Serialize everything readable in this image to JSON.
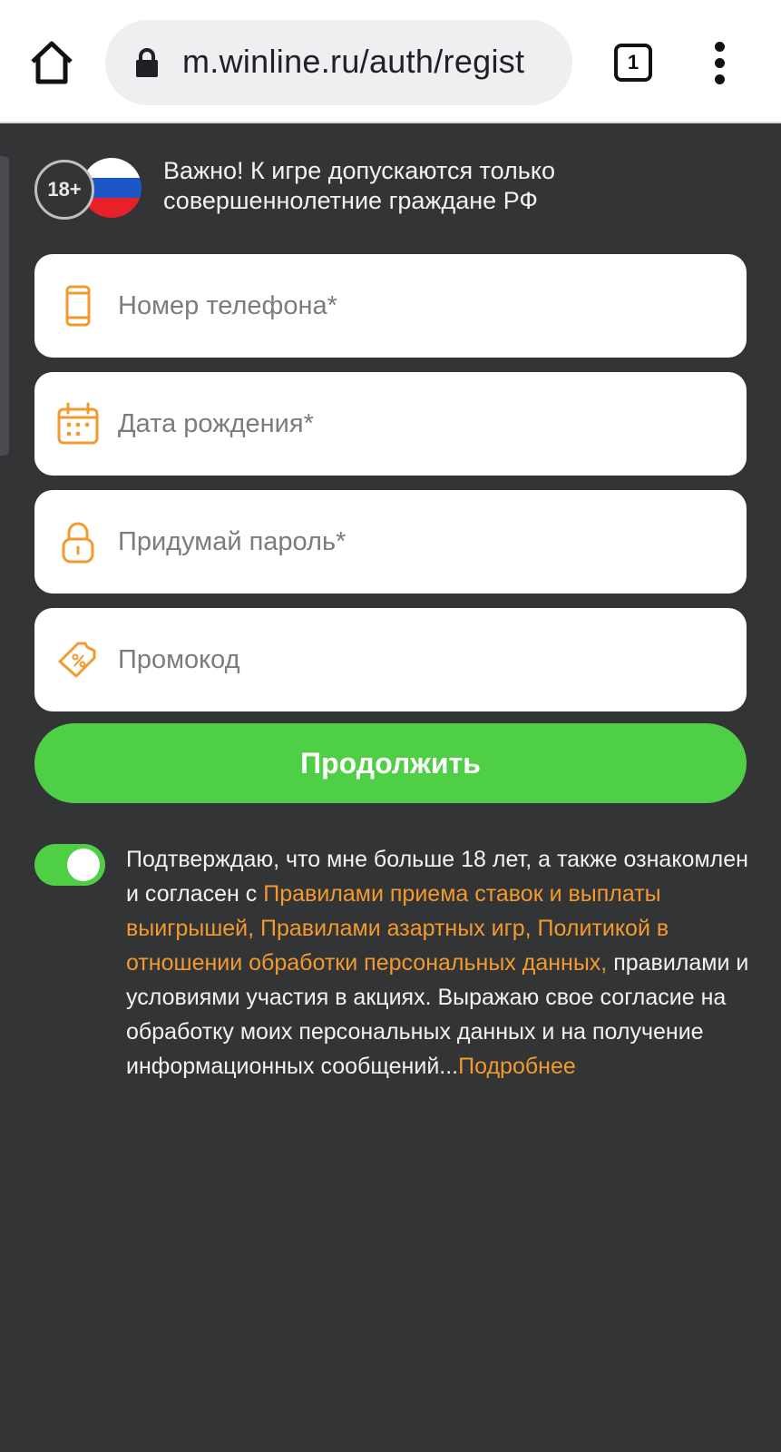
{
  "browser": {
    "url": "m.winline.ru/auth/regist",
    "tab_count": "1",
    "home_icon": "home-icon",
    "lock_icon": "lock-icon",
    "menu_icon": "more-vert-icon"
  },
  "notice": {
    "age_badge": "18+",
    "flag_icon": "russia-flag-icon",
    "text": "Важно! К игре допускаются только совершеннолетние граждане РФ"
  },
  "form": {
    "phone": {
      "placeholder": "Номер телефона*",
      "value": "",
      "icon": "phone-icon"
    },
    "birthdate": {
      "placeholder": "Дата рождения*",
      "value": "",
      "icon": "calendar-icon"
    },
    "password": {
      "placeholder": "Придумай пароль*",
      "value": "",
      "icon": "lock-icon"
    },
    "promo": {
      "placeholder": "Промокод",
      "value": "",
      "icon": "promo-ticket-icon"
    },
    "continue_label": "Продолжить"
  },
  "consent": {
    "toggle_on": true,
    "text_1": "Подтверждаю, что мне больше 18 лет, а также ознакомлен и согласен с ",
    "link_rules_bets": "Правилами приема ставок и выплаты выигрышей,",
    "link_rules_games": "Правилами азартных игр,",
    "link_privacy": "Политикой в отношении обработки персональных данных,",
    "text_2": " правилами и условиями участия в акциях. Выражаю свое согласие на обработку моих персональных данных и на получение информационных сообщений...",
    "link_more": "Подробнее"
  },
  "colors": {
    "background": "#333436",
    "accent_green": "#4fcf46",
    "accent_orange": "#f29a2e"
  }
}
